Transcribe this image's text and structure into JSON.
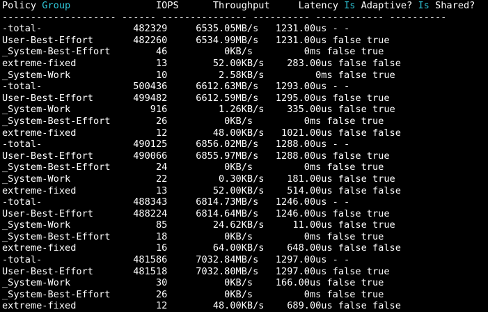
{
  "colors": {
    "background": "#000000",
    "text": "#ffffff",
    "keyword": "#2ec4d6"
  },
  "header": {
    "policy": "Policy ",
    "group": "Group",
    "mid": "               IOPS      Throughput     Latency ",
    "is1": "Is",
    "adaptive": " Adaptive? ",
    "is2": "Is",
    "shared": " Shared?"
  },
  "separator": "-------------------- ------ --------------- ---------- ------------ ----------",
  "rows": [
    "-total-                482329     6535.05MB/s   1231.00us - -",
    "User-Best-Effort       482260     6534.99MB/s   1231.00us false true",
    "_System-Best-Effort        46          0KB/s         0ms false true",
    "extreme-fixed              13        52.00KB/s    283.00us false false",
    "_System-Work               10         2.58KB/s         0ms false true",
    "-total-                500436     6612.63MB/s   1293.00us - -",
    "User-Best-Effort       499482     6612.59MB/s   1295.00us false true",
    "_System-Work              916         1.26KB/s    335.00us false true",
    "_System-Best-Effort        26          0KB/s         0ms false true",
    "extreme-fixed              12        48.00KB/s   1021.00us false false",
    "-total-                490125     6856.02MB/s   1288.00us - -",
    "User-Best-Effort       490066     6855.97MB/s   1288.00us false true",
    "_System-Best-Effort        24          0KB/s         0ms false true",
    "_System-Work               22         0.30KB/s    181.00us false true",
    "extreme-fixed              13        52.00KB/s    514.00us false false",
    "-total-                488343     6814.73MB/s   1246.00us - -",
    "User-Best-Effort       488224     6814.64MB/s   1246.00us false true",
    "_System-Work               85        24.62KB/s     11.00us false true",
    "_System-Best-Effort        18          0KB/s         0ms false true",
    "extreme-fixed              16        64.00KB/s    648.00us false false",
    "-total-                481586     7032.84MB/s   1297.00us - -",
    "User-Best-Effort       481518     7032.80MB/s   1297.00us false true",
    "_System-Work               30          0KB/s    166.00us false true",
    "_System-Best-Effort        26          0KB/s         0ms false true",
    "extreme-fixed              12        48.00KB/s    689.00us false false"
  ]
}
